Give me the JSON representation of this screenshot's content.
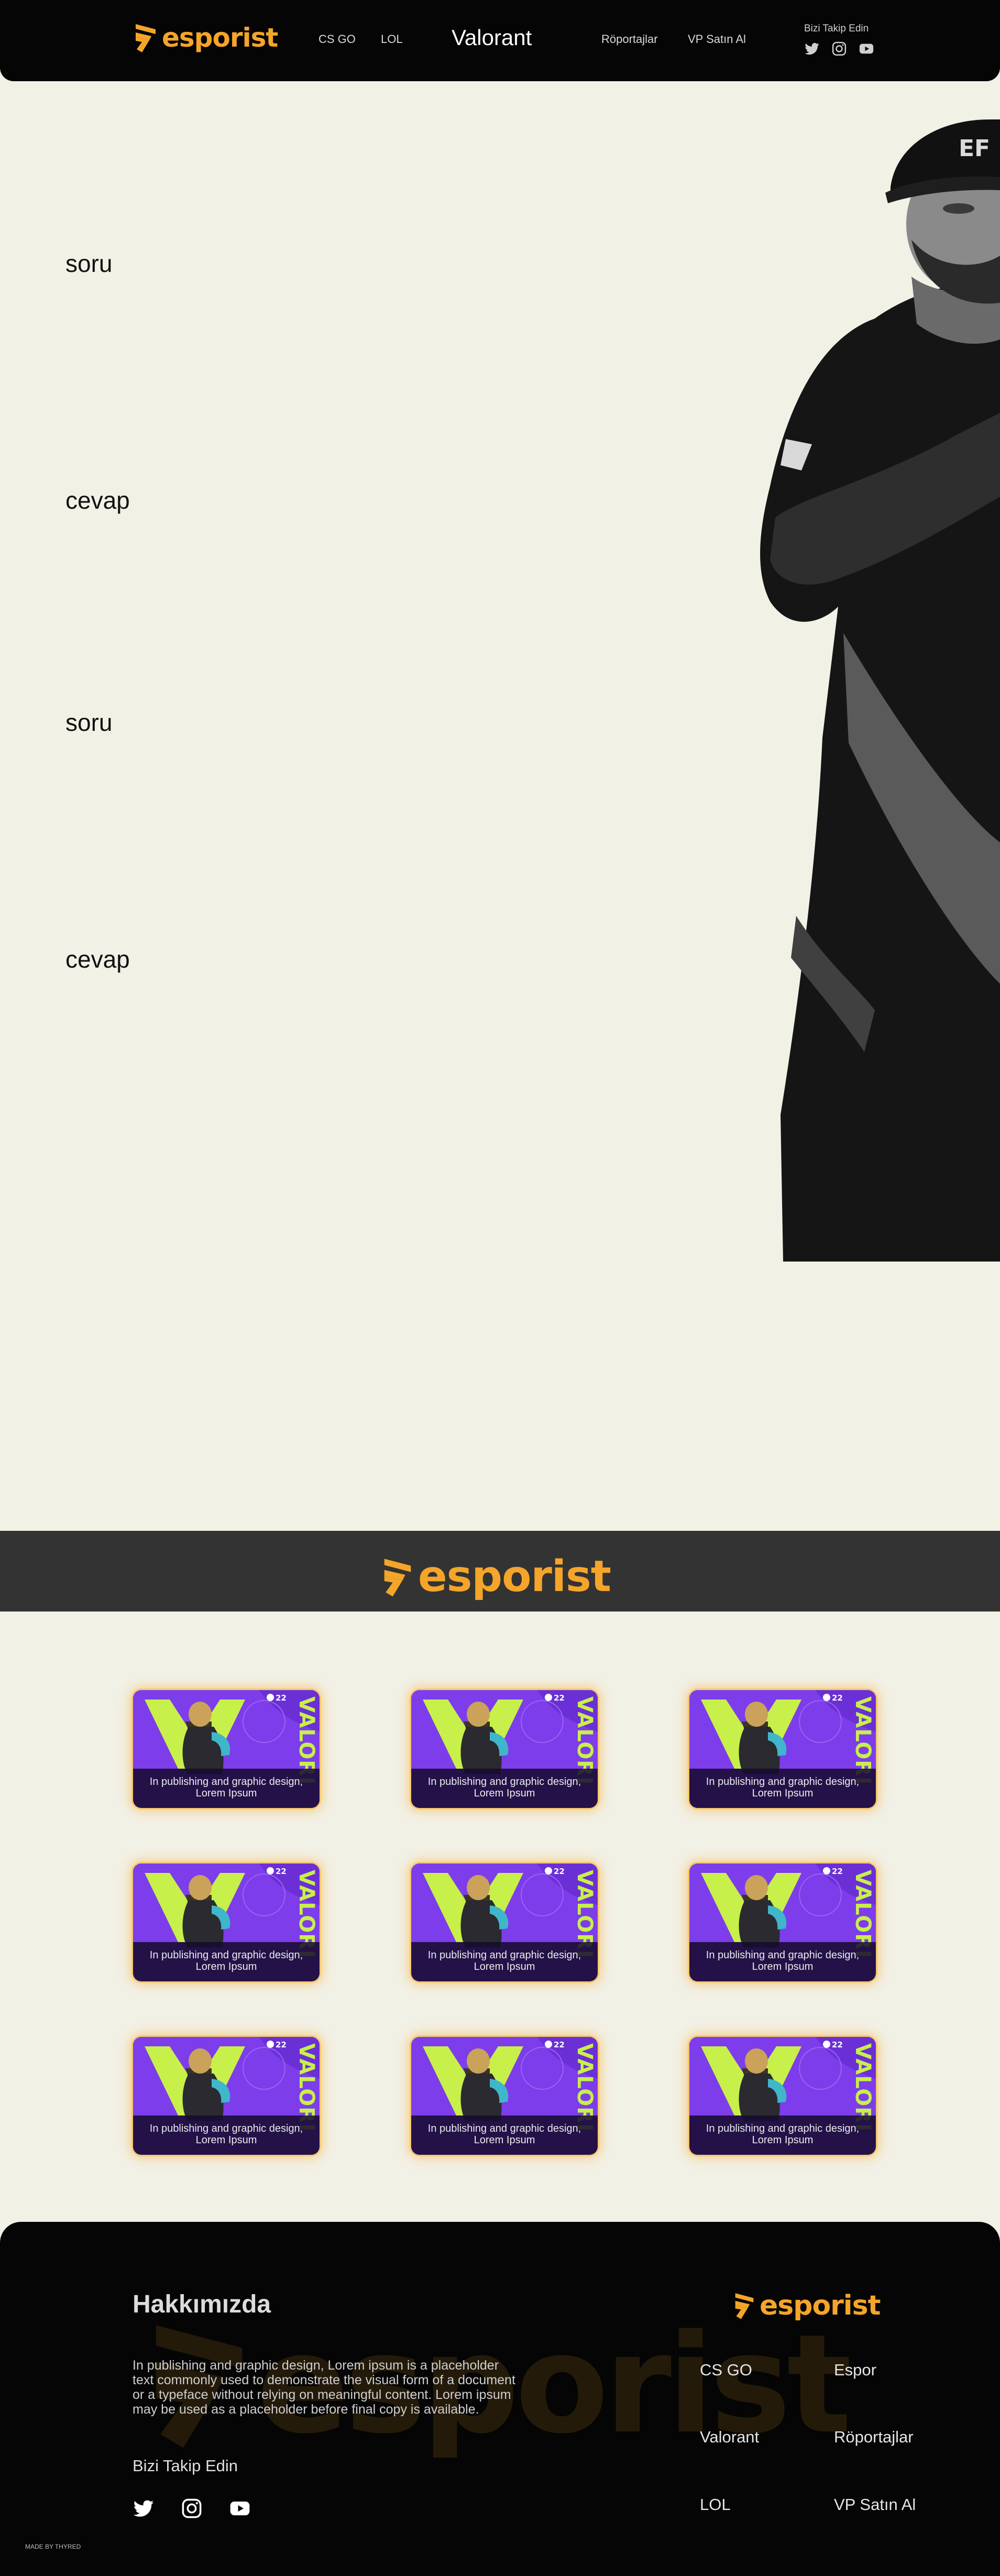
{
  "header": {
    "brand": "esporist",
    "nav_left": [
      "CS GO",
      "LOL"
    ],
    "nav_center": "Valorant",
    "nav_right": [
      "Röportajlar",
      "VP Satın Al"
    ],
    "follow_label": "Bizi Takip Edin",
    "social_icons": [
      "twitter-icon",
      "instagram-icon",
      "youtube-icon"
    ]
  },
  "faq": [
    {
      "label": "soru"
    },
    {
      "label": "cevap"
    },
    {
      "label": "soru"
    },
    {
      "label": "cevap"
    }
  ],
  "banner": {
    "brand": "esporist"
  },
  "cards": {
    "badge": "22",
    "side_text": "VALORI",
    "items": [
      {
        "caption": "In publishing and graphic design, Lorem Ipsum"
      },
      {
        "caption": "In publishing and graphic design, Lorem Ipsum"
      },
      {
        "caption": "In publishing and graphic design, Lorem Ipsum"
      },
      {
        "caption": "In publishing and graphic design, Lorem Ipsum"
      },
      {
        "caption": "In publishing and graphic design, Lorem Ipsum"
      },
      {
        "caption": "In publishing and graphic design, Lorem Ipsum"
      },
      {
        "caption": "In publishing and graphic design, Lorem Ipsum"
      },
      {
        "caption": "In publishing and graphic design, Lorem Ipsum"
      },
      {
        "caption": "In publishing and graphic design, Lorem Ipsum"
      }
    ]
  },
  "footer": {
    "about_title": "Hakkımızda",
    "about_lines": [
      "In publishing and graphic design, Lorem ipsum is a placeholder",
      "text commonly used to demonstrate the visual form of a document",
      " or a typeface without relying on meaningful content. Lorem ipsum",
      "may be used as a placeholder before final copy is available."
    ],
    "follow_label": "Bizi Takip Edin",
    "brand": "esporist",
    "links": [
      "CS GO",
      "Espor",
      "Valorant",
      "Röportajlar",
      "LOL",
      "VP Satın Al"
    ],
    "made_by": "MADE BY THYRED"
  },
  "colors": {
    "accent": "#f4a52a",
    "background": "#f2f1e6",
    "dark": "#050505",
    "banner": "#333333",
    "card_purple": "#7d3dea",
    "card_lime": "#c8f04a"
  }
}
